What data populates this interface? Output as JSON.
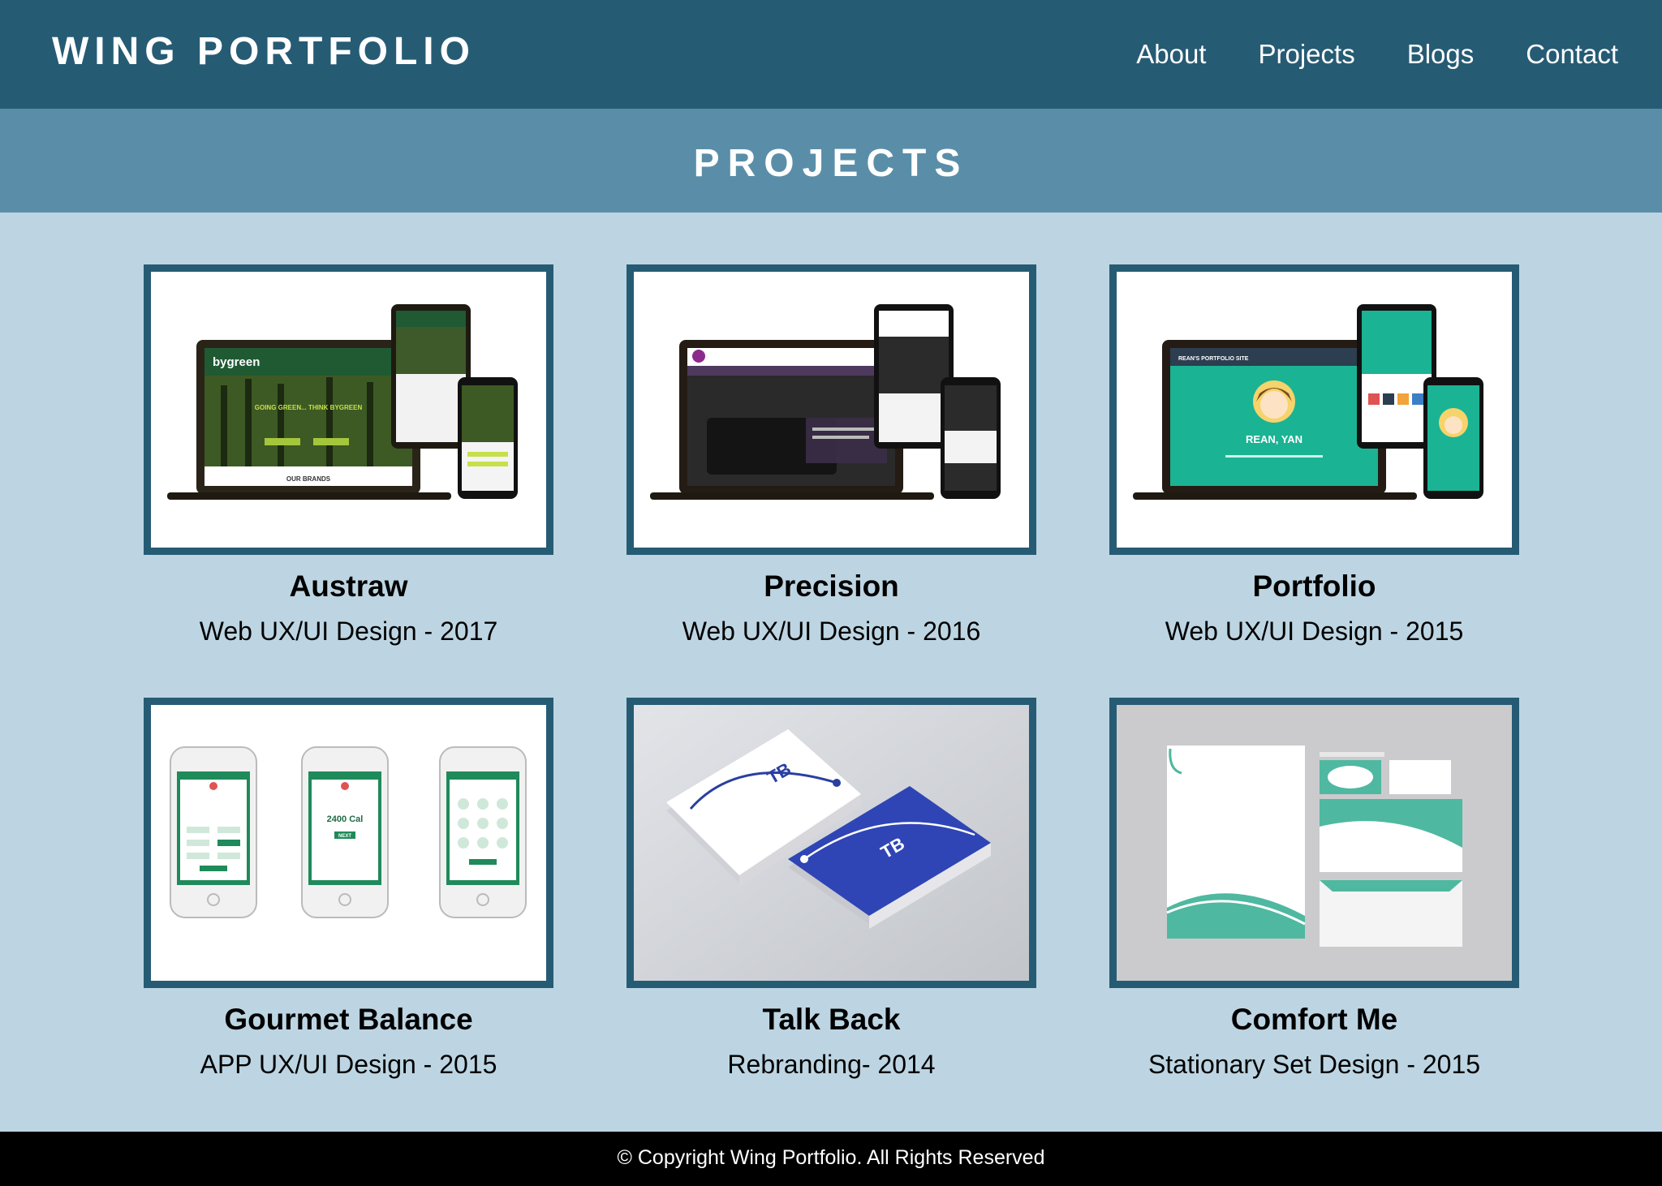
{
  "header": {
    "brand": "WING PORTFOLIO",
    "nav": [
      "About",
      "Projects",
      "Blogs",
      "Contact"
    ]
  },
  "banner": {
    "title": "PROJECTS"
  },
  "projects": [
    {
      "title": "Austraw",
      "subtitle": "Web UX/UI Design - 2017"
    },
    {
      "title": "Precision",
      "subtitle": "Web UX/UI Design - 2016"
    },
    {
      "title": "Portfolio",
      "subtitle": "Web UX/UI Design - 2015"
    },
    {
      "title": "Gourmet Balance",
      "subtitle": "APP UX/UI Design - 2015"
    },
    {
      "title": "Talk Back",
      "subtitle": "Rebranding- 2014"
    },
    {
      "title": "Comfort Me",
      "subtitle": "Stationary Set Design - 2015"
    }
  ],
  "mockups": {
    "austraw": {
      "logo": "bygreen",
      "headline": "GOING GREEN... THINK BYGREEN",
      "section": "OUR BRANDS"
    },
    "portfolio": {
      "site": "REAN'S PORTFOLIO SITE",
      "name": "REAN, YAN"
    },
    "gourmet": {
      "calories": "2400 Cal",
      "button": "NEXT"
    }
  },
  "footer": {
    "copyright": "© Copyright Wing Portfolio. All Rights Reserved"
  },
  "colors": {
    "header": "#265b74",
    "banner": "#5a8ea8",
    "page": "#bdd5e2",
    "footer": "#000000"
  }
}
